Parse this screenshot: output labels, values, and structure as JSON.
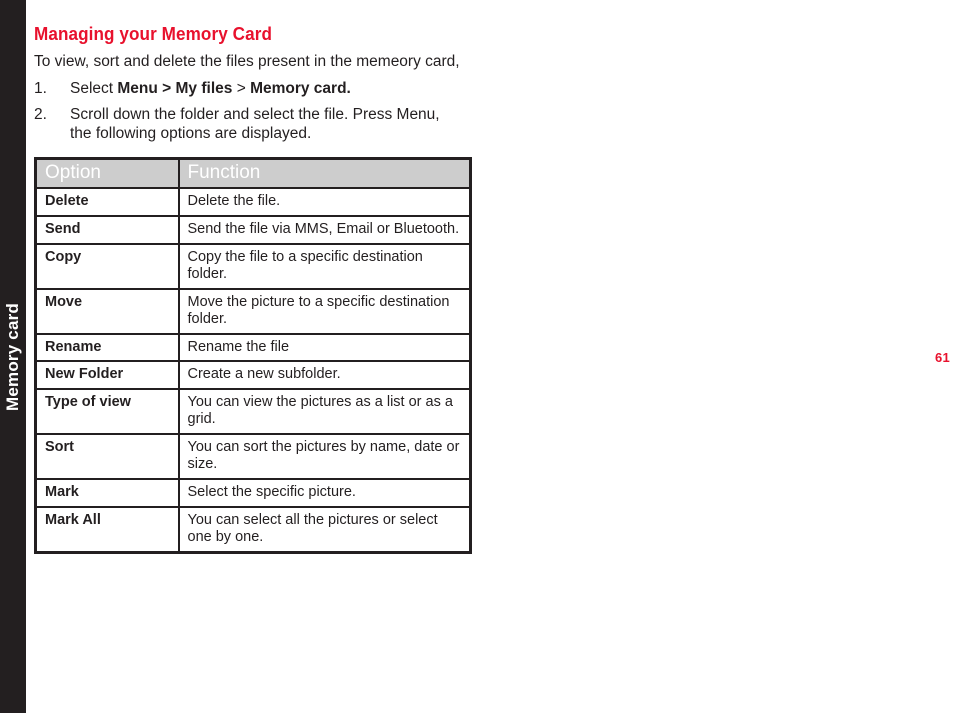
{
  "side_tab": {
    "label": "Memory card"
  },
  "page_number": "61",
  "heading": "Managing your Memory Card",
  "intro": "To view, sort and delete the files present in the memeory card,",
  "steps": [
    {
      "number": "1.",
      "prefix": "Select ",
      "bold1": "Menu > My files",
      "separator": " > ",
      "bold2": "Memory card.",
      "suffix": ""
    },
    {
      "number": "2.",
      "prefix": "Scroll down the folder and select the file. Press Menu, the following options are displayed.",
      "bold1": "",
      "separator": "",
      "bold2": "",
      "suffix": ""
    }
  ],
  "table": {
    "headers": [
      "Option",
      "Function"
    ],
    "rows": [
      {
        "option": "Delete",
        "function": "Delete the file."
      },
      {
        "option": "Send",
        "function": "Send the file via MMS, Email or Bluetooth."
      },
      {
        "option": "Copy",
        "function": "Copy the file to a specific destination folder."
      },
      {
        "option": "Move",
        "function": "Move the picture to a specific destination folder."
      },
      {
        "option": "Rename",
        "function": "Rename the file"
      },
      {
        "option": "New Folder",
        "function": "Create a new subfolder."
      },
      {
        "option": "Type of view",
        "function": "You can view the pictures as a list or as a grid."
      },
      {
        "option": "Sort",
        "function": "You can sort the pictures by name, date or size."
      },
      {
        "option": "Mark",
        "function": "Select the specific picture."
      },
      {
        "option": "Mark All",
        "function": "You can select all the pictures or select one by one."
      }
    ]
  },
  "colors": {
    "accent_red": "#e8112d",
    "tab_dark": "#231f20",
    "header_gray": "#cdcdcd",
    "text": "#231f20"
  }
}
